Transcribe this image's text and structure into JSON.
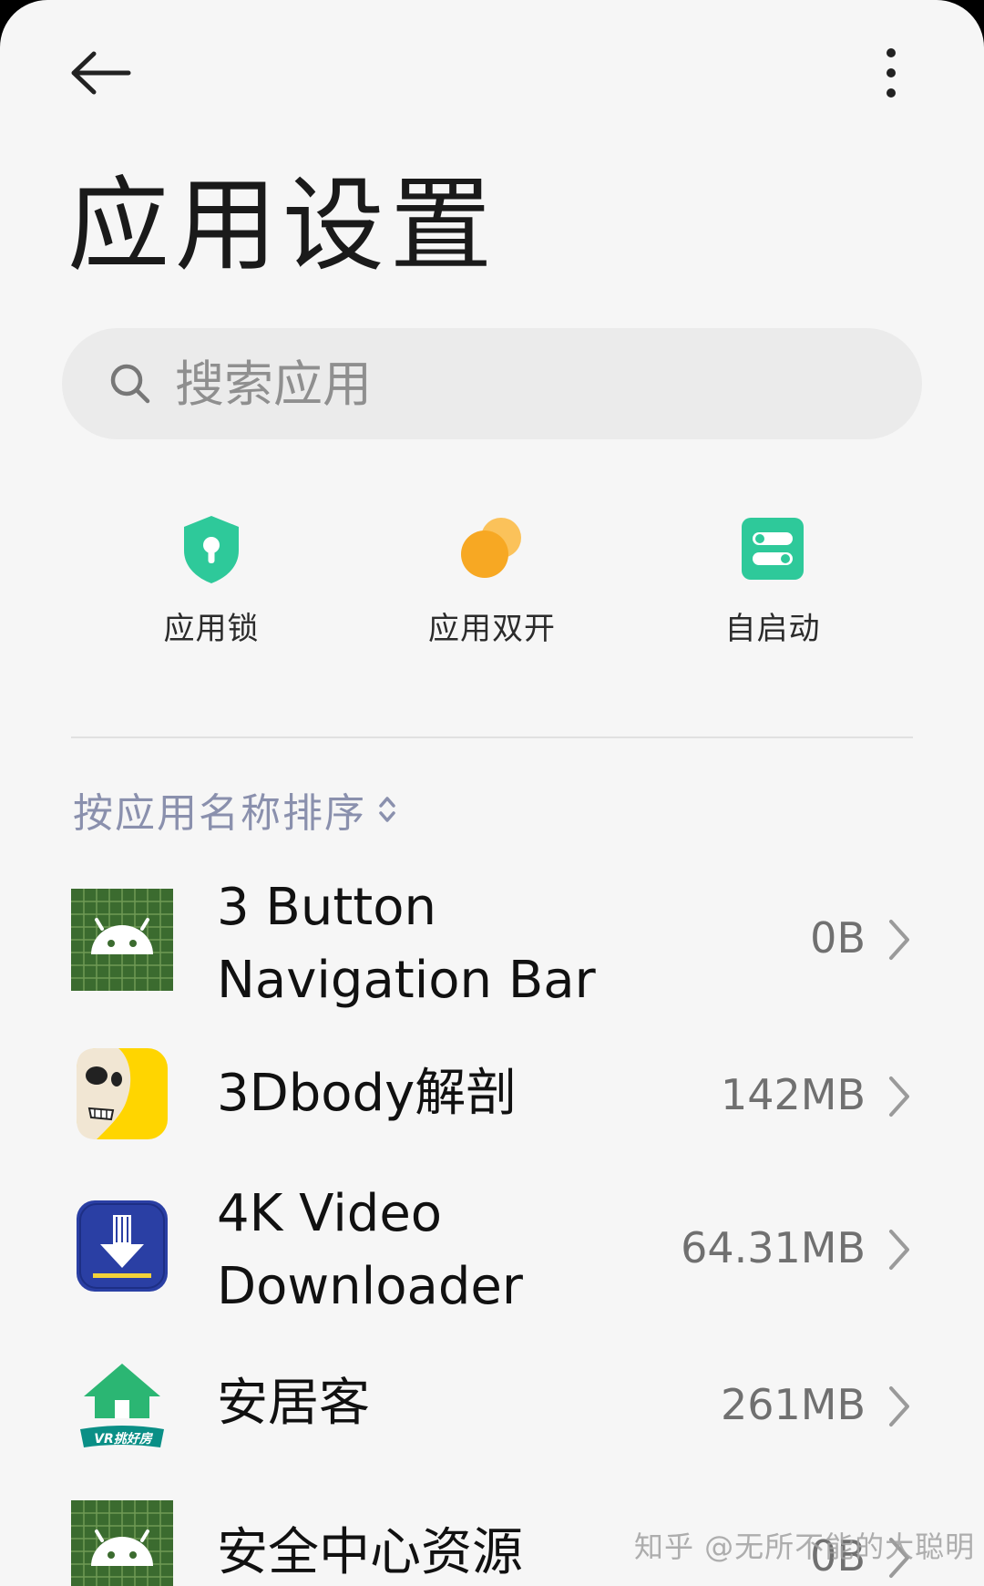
{
  "header": {
    "back_icon": "arrow-left-icon",
    "more_icon": "more-vertical-icon"
  },
  "page": {
    "title": "应用设置"
  },
  "search": {
    "placeholder": "搜索应用",
    "icon": "search-icon"
  },
  "quick_actions": [
    {
      "label": "应用锁",
      "icon": "shield-lock-icon",
      "color": "#2ec99a"
    },
    {
      "label": "应用双开",
      "icon": "dual-circles-icon",
      "color": "#f7a823"
    },
    {
      "label": "自启动",
      "icon": "toggle-switches-icon",
      "color": "#2ec99a"
    }
  ],
  "sort": {
    "label": "按应用名称排序",
    "icon": "sort-updown-icon"
  },
  "apps": [
    {
      "name": "3 Button Navigation Bar",
      "size": "0B",
      "icon": "android-icon"
    },
    {
      "name": "3Dbody解剖",
      "size": "142MB",
      "icon": "skull-icon"
    },
    {
      "name": "4K Video Downloader",
      "size": "64.31MB",
      "icon": "download-icon"
    },
    {
      "name": "安居客",
      "size": "261MB",
      "icon": "house-icon",
      "icon_caption": "VR挑好房"
    },
    {
      "name": "安全中心资源",
      "size": "0B",
      "icon": "android-icon"
    }
  ],
  "watermark": "知乎 @无所不能的大聪明",
  "colors": {
    "background": "#f6f6f6",
    "accent_green": "#2ec99a",
    "accent_orange": "#f7a823",
    "sort_text": "#8a90ad"
  }
}
